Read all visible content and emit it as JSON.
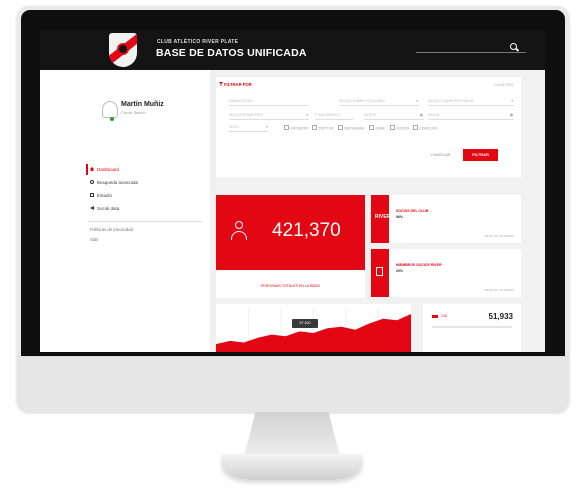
{
  "header": {
    "club_name": "CLUB ATLÉTICO RIVER PLATE",
    "title": "BASE DE DATOS UNIFICADA"
  },
  "user": {
    "name": "Martín Muñiz",
    "subtitle": "Cerrar Sesión"
  },
  "nav": {
    "items": [
      {
        "label": "Dashboard",
        "icon": "home-icon",
        "active": true
      },
      {
        "label": "Busqueda avanzada",
        "icon": "search-icon",
        "active": false
      },
      {
        "label": "Estadio",
        "icon": "grid-icon",
        "active": false
      },
      {
        "label": "Social data",
        "icon": "share-icon",
        "active": false
      }
    ],
    "links": [
      "Políticas de privacidad",
      "Salir"
    ]
  },
  "filter": {
    "title": "FILTRAR POR",
    "toggle": "OCULTAR",
    "fields": [
      "RANGO EDAD",
      "SELECCIONAR LOCALIDAD",
      "SELECCIONAR PROVINCIA",
      "SELECCIONAR PAIS",
      "F. NACIMIENTO",
      "DESDE",
      "HASTA",
      "SEXO"
    ],
    "channels": [
      "FACEBOOK",
      "TWITTER",
      "INSTAGRAM",
      "EMAIL",
      "SOCIOS",
      "CONCILIOS"
    ],
    "cancel_label": "CANCELAR",
    "submit_label": "FILTRAR"
  },
  "stats": {
    "total_value": "421,370",
    "total_caption": "PERSONAS TOTALES EN LA BBDD",
    "socios": {
      "icon_text": "RIVER",
      "label": "SOCIOS DEL CLUB",
      "value": "96%",
      "link": "DETALLE USUARIOS"
    },
    "members": {
      "label": "MIEMBROS SOCIOS RIVER",
      "value": "20%",
      "link": "DETALLE USUARIOS"
    }
  },
  "chart_data": {
    "type": "area",
    "tooltip": "57.400",
    "values": [
      10,
      14,
      12,
      18,
      22,
      20,
      26,
      24,
      30,
      32,
      28,
      36,
      42,
      40,
      48
    ],
    "color": "#e30613"
  },
  "side_metric": {
    "label": "2.50",
    "value": "51,933"
  }
}
